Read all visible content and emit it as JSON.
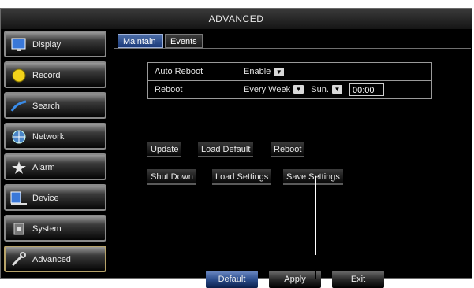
{
  "window": {
    "title": "ADVANCED"
  },
  "sidebar": {
    "items": [
      {
        "label": "Display",
        "icon": "monitor-icon"
      },
      {
        "label": "Record",
        "icon": "record-icon"
      },
      {
        "label": "Search",
        "icon": "magnifier-icon"
      },
      {
        "label": "Network",
        "icon": "network-icon"
      },
      {
        "label": "Alarm",
        "icon": "alarm-icon"
      },
      {
        "label": "Device",
        "icon": "device-icon"
      },
      {
        "label": "System",
        "icon": "system-icon"
      },
      {
        "label": "Advanced",
        "icon": "wrench-icon",
        "active": true
      }
    ]
  },
  "tabs": [
    {
      "label": "Maintain",
      "active": true
    },
    {
      "label": "Events",
      "active": false
    }
  ],
  "settings": {
    "auto_reboot": {
      "label": "Auto Reboot",
      "value": "Enable"
    },
    "reboot": {
      "label": "Reboot",
      "frequency": "Every Week",
      "day": "Sun.",
      "time": "00:00"
    }
  },
  "actions": {
    "update": "Update",
    "load_default": "Load Default",
    "reboot": "Reboot",
    "shut_down": "Shut Down",
    "load_settings": "Load Settings",
    "save_settings": "Save Settings"
  },
  "footer": {
    "default": "Default",
    "apply": "Apply",
    "exit": "Exit"
  },
  "colors": {
    "active_tab": "#2f5596",
    "background": "#000000",
    "window_border": "#6a6a6a"
  }
}
